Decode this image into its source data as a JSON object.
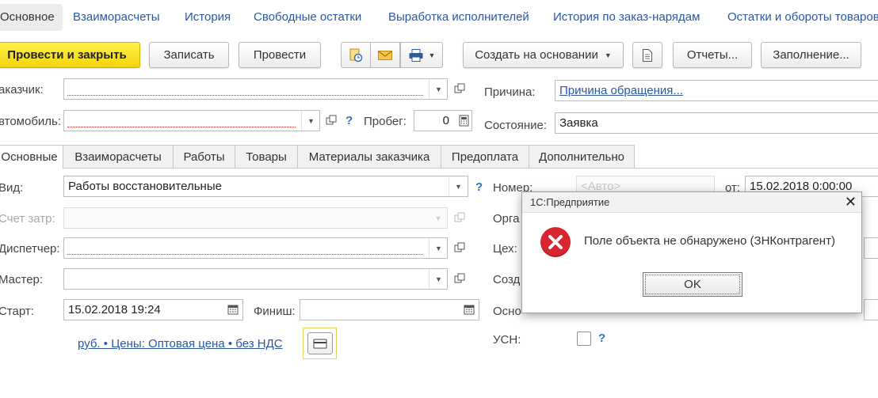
{
  "nav_tabs": [
    {
      "label": "Основное",
      "active": true
    },
    {
      "label": "Взаиморасчеты"
    },
    {
      "label": "История"
    },
    {
      "label": "Свободные остатки"
    },
    {
      "label": "Выработка исполнителей"
    },
    {
      "label": "История по заказ-нарядам"
    },
    {
      "label": "Остатки и обороты товаров"
    }
  ],
  "toolbar": {
    "post_close": "Провести и закрыть",
    "save": "Записать",
    "post": "Провести",
    "create_based": "Создать на основании",
    "reports": "Отчеты...",
    "fill": "Заполнение..."
  },
  "header_form": {
    "customer_label": "аказчик:",
    "customer_value": "",
    "car_label": "втомобиль:",
    "car_value": "",
    "mileage_label": "Пробег:",
    "mileage_value": "0",
    "reason_label": "Причина:",
    "reason_link": "Причина обращения...",
    "state_label": "Состояние:",
    "state_value": "Заявка",
    "help": "?"
  },
  "sub_tabs": [
    {
      "label": "Основные",
      "active": true
    },
    {
      "label": "Взаиморасчеты"
    },
    {
      "label": "Работы"
    },
    {
      "label": "Товары"
    },
    {
      "label": "Материалы заказчика"
    },
    {
      "label": "Предоплата"
    },
    {
      "label": "Дополнительно"
    }
  ],
  "main_form": {
    "type_label": "Вид:",
    "type_value": "Работы восстановительные",
    "cost_account_label": "Счет затр:",
    "dispatcher_label": "Диспетчер:",
    "master_label": "Мастер:",
    "start_label": "Старт:",
    "start_value": "15.02.2018 19:24",
    "finish_label": "Финиш:",
    "finish_value": " .  .       :  ",
    "price_link": "руб. • Цены: Оптовая цена • без НДС",
    "number_label": "Номер:",
    "number_placeholder": "<Авто>",
    "date_from_label": "от:",
    "date_value": "15.02.2018  0:00:00",
    "org_label": "Орга",
    "shop_label": "Цех:",
    "created_label": "Созд",
    "basis_label": "Осно",
    "usn_label": "УСН:",
    "help": "?"
  },
  "dialog": {
    "title": "1С:Предприятие",
    "message": "Поле объекта не обнаружено (ЗНКонтрагент)",
    "ok": "OK"
  },
  "colors": {
    "link": "#2a57a5",
    "primary_button": "#f2d40c",
    "error_icon": "#d9252f",
    "required_underline": "#d23a3a"
  }
}
